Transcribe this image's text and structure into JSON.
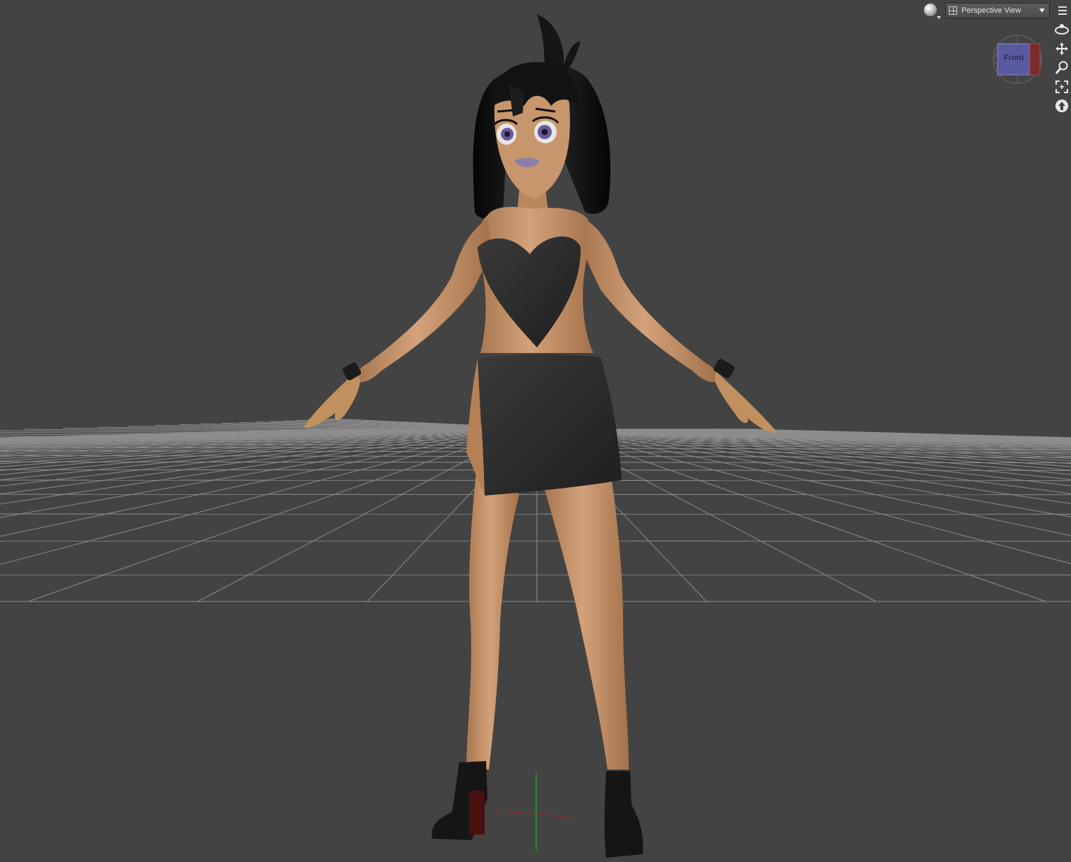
{
  "viewport": {
    "view_menu_label": "Perspective View",
    "view_cube_face": "Front",
    "background_color": "#434343",
    "grid_color": "#9a9a9a"
  },
  "toolbar": {
    "draw_style_icon": "sphere-icon",
    "view_icon": "grid-icon",
    "options_icon": "menu-icon"
  },
  "nav_tools": [
    {
      "name": "orbit",
      "icon": "orbit-icon"
    },
    {
      "name": "pan",
      "icon": "pan-icon"
    },
    {
      "name": "zoom",
      "icon": "zoom-icon"
    },
    {
      "name": "frame",
      "icon": "frame-icon"
    },
    {
      "name": "reset",
      "icon": "reset-icon"
    }
  ],
  "scene": {
    "figure": "3d-character",
    "skin_color": "#c9976b",
    "hair_color": "#111111",
    "clothing_color": "#262626",
    "axis_y_color": "#1fb81f",
    "axis_x_color": "#c12020"
  }
}
